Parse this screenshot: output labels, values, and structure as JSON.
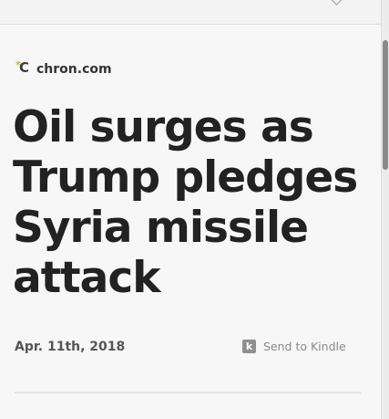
{
  "source": {
    "name": "chron.com",
    "logo_icon": "chron-logo-icon"
  },
  "article": {
    "headline": "Oil surges as Trump pledges Syria missile attack",
    "date": "Apr. 11th, 2018"
  },
  "actions": {
    "send_to_kindle_label": "Send to Kindle",
    "kindle_icon_glyph": "k"
  },
  "colors": {
    "background": "#f7f7f7",
    "headline": "#222222",
    "muted": "#8a8a8a"
  }
}
